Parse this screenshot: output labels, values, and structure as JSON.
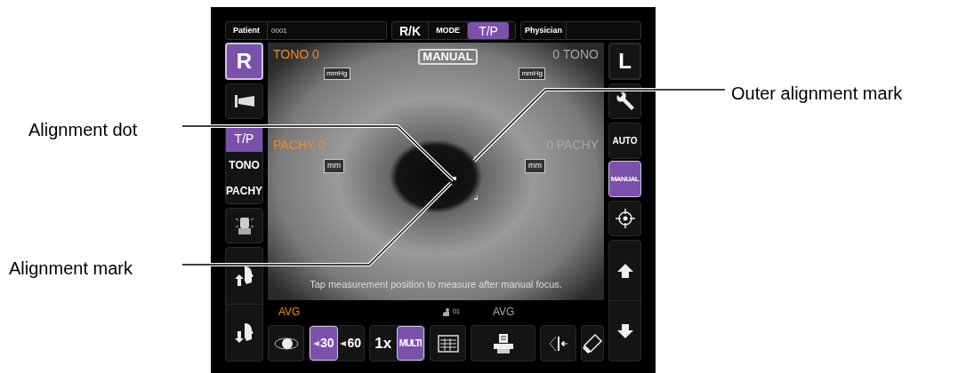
{
  "callouts": [
    {
      "text": "Alignment dot"
    },
    {
      "text": "Alignment mark"
    },
    {
      "text": "Outer alignment mark"
    }
  ],
  "top_bar": {
    "patient_label": "Patient",
    "patient_value": "0001",
    "mode_label": "MODE",
    "physician_label": "Physician",
    "mode_options": [
      {
        "label": "R/K",
        "selected": false
      },
      {
        "label": "T/P",
        "selected": true
      }
    ]
  },
  "eyes": [
    {
      "label": "R",
      "selected": true
    },
    {
      "label": "L",
      "selected": false
    }
  ],
  "measurements": [
    {
      "label": "T/P",
      "selected": true
    },
    {
      "label": "TONO",
      "selected": false
    },
    {
      "label": "PACHY",
      "selected": false
    }
  ],
  "focus_modes": [
    {
      "label": "AUTO",
      "selected": false
    },
    {
      "label": "MANUAL",
      "selected": true
    }
  ],
  "viewport": {
    "mode_badge": "MANUAL",
    "message": "Tap measurement position to measure after manual focus.",
    "count": "01",
    "readouts": [
      {
        "tono": "TONO 0",
        "tono_unit": "mmHg",
        "pachy": "PACHY 0",
        "pachy_unit": "mm",
        "avg": "AVG",
        "active": true
      },
      {
        "tono": "0 TONO",
        "tono_unit": "mmHg",
        "pachy": "0 PACHY",
        "pachy_unit": "mm",
        "avg": "AVG",
        "active": false
      }
    ]
  },
  "angles": [
    {
      "label": "30",
      "selected": true
    },
    {
      "label": "60",
      "selected": false
    }
  ],
  "magnification": [
    {
      "label": "1x",
      "selected": false
    },
    {
      "label": "MULTI",
      "selected": true
    }
  ]
}
